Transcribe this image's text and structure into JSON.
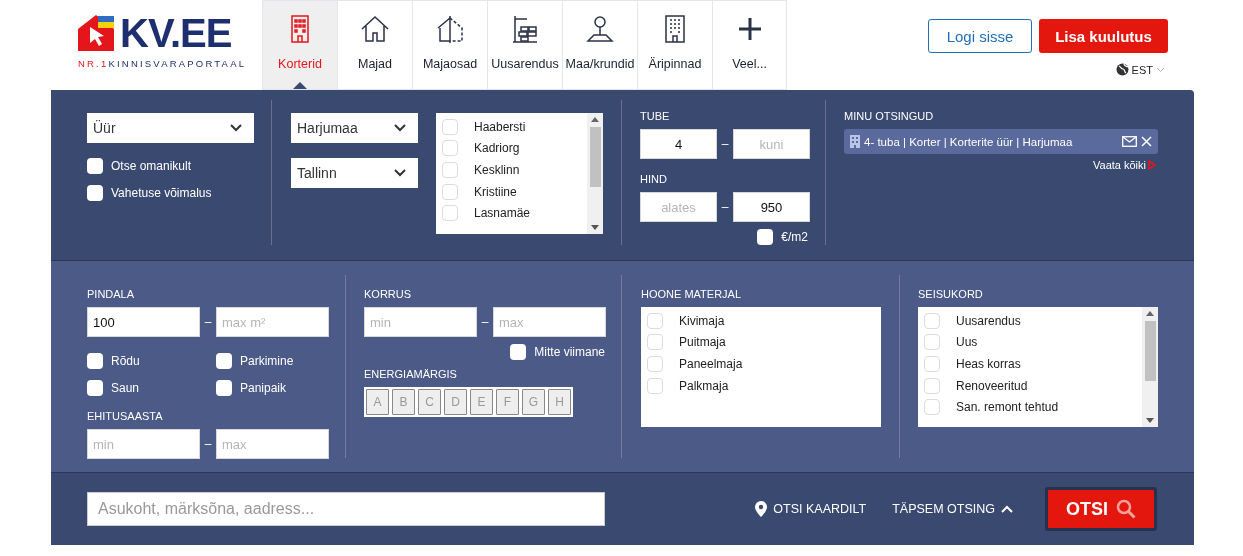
{
  "header": {
    "logo": {
      "name": "KV.EE",
      "tagline_prefix": "NR.1",
      "tagline": "KINNISVARAPORTAAL"
    },
    "tabs": [
      {
        "label": "Korterid",
        "selected": true
      },
      {
        "label": "Majad",
        "selected": false
      },
      {
        "label": "Majaosad",
        "selected": false
      },
      {
        "label": "Uusarendus",
        "selected": false
      },
      {
        "label": "Maa/krundid",
        "selected": false
      },
      {
        "label": "Äripinnad",
        "selected": false
      },
      {
        "label": "Veel...",
        "selected": false
      }
    ],
    "login_button": "Logi sisse",
    "add_button": "Lisa kuulutus",
    "language": "EST"
  },
  "search": {
    "deal_type": "Üür",
    "options": [
      {
        "label": "Otse omanikult",
        "checked": false
      },
      {
        "label": "Vahetuse võimalus",
        "checked": false
      }
    ],
    "county": "Harjumaa",
    "city": "Tallinn",
    "districts": [
      {
        "label": "Haabersti",
        "checked": false
      },
      {
        "label": "Kadriorg",
        "checked": false
      },
      {
        "label": "Kesklinn",
        "checked": false
      },
      {
        "label": "Kristiine",
        "checked": false
      },
      {
        "label": "Lasnamäe",
        "checked": false
      }
    ],
    "rooms": {
      "label": "TUBE",
      "from": {
        "value": "4"
      },
      "separator": "–",
      "to": {
        "placeholder": "kuni"
      }
    },
    "price": {
      "label": "HIND",
      "from": {
        "placeholder": "alates"
      },
      "separator": "–",
      "to": {
        "value": "950"
      },
      "per_m2": {
        "label": "€/m2",
        "checked": false
      }
    },
    "saved_searches": {
      "title": "MINU OTSINGUD",
      "items": [
        {
          "text": "4- tuba | Korter | Korterite üür | Harjumaa"
        }
      ],
      "view_all": "Vaata kõiki"
    }
  },
  "details": {
    "area": {
      "label": "PINDALA",
      "from": {
        "value": "100"
      },
      "separator": "–",
      "to": {
        "placeholder": "max m²"
      }
    },
    "features": [
      {
        "label": "Rõdu",
        "checked": false
      },
      {
        "label": "Parkimine",
        "checked": false
      },
      {
        "label": "Saun",
        "checked": false
      },
      {
        "label": "Panipaik",
        "checked": false
      }
    ],
    "year": {
      "label": "EHITUSAASTA",
      "from": {
        "placeholder": "min"
      },
      "separator": "–",
      "to": {
        "placeholder": "max"
      }
    },
    "floor": {
      "label": "KORRUS",
      "from": {
        "placeholder": "min"
      },
      "separator": "–",
      "to": {
        "placeholder": "max"
      },
      "not_last": {
        "label": "Mitte viimane",
        "checked": false
      }
    },
    "energy": {
      "label": "ENERGIAMÄRGIS",
      "classes": [
        {
          "label": "A",
          "selected": false
        },
        {
          "label": "B",
          "selected": false
        },
        {
          "label": "C",
          "selected": false
        },
        {
          "label": "D",
          "selected": false
        },
        {
          "label": "E",
          "selected": false
        },
        {
          "label": "F",
          "selected": false
        },
        {
          "label": "G",
          "selected": false
        },
        {
          "label": "H",
          "selected": false
        }
      ]
    },
    "material": {
      "label": "HOONE MATERJAL",
      "items": [
        {
          "label": "Kivimaja",
          "checked": false
        },
        {
          "label": "Puitmaja",
          "checked": false
        },
        {
          "label": "Paneelmaja",
          "checked": false
        },
        {
          "label": "Palkmaja",
          "checked": false
        }
      ]
    },
    "condition": {
      "label": "SEISUKORD",
      "items": [
        {
          "label": "Uusarendus",
          "checked": false
        },
        {
          "label": "Uus",
          "checked": false
        },
        {
          "label": "Heas korras",
          "checked": false
        },
        {
          "label": "Renoveeritud",
          "checked": false
        },
        {
          "label": "San. remont tehtud",
          "checked": false
        }
      ]
    }
  },
  "bottom": {
    "search_placeholder": "Asukoht, märksõna, aadress...",
    "map_link": "OTSI KAARDILT",
    "advanced_link": "TÄPSEM OTSING",
    "advanced_expanded": true,
    "search_button": "OTSI"
  }
}
